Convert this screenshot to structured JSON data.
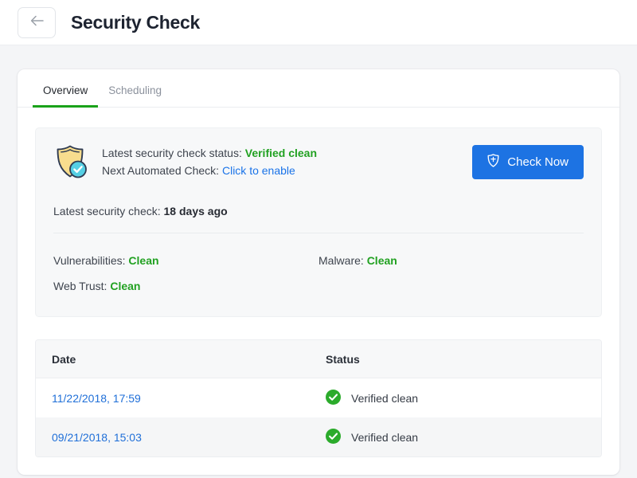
{
  "header": {
    "back_icon": "arrow-left-icon",
    "title": "Security Check"
  },
  "tabs": [
    {
      "label": "Overview",
      "active": true
    },
    {
      "label": "Scheduling",
      "active": false
    }
  ],
  "summary": {
    "shield_icon": "shield-check-icon",
    "status_label": "Latest security check status:",
    "status_value": "Verified clean",
    "next_check_label": "Next Automated Check:",
    "next_check_action": "Click to enable",
    "check_now_label": "Check Now",
    "check_now_icon": "shield-icon",
    "latest_label": "Latest security check:",
    "latest_value": "18 days ago",
    "metrics": [
      {
        "label": "Vulnerabilities:",
        "value": "Clean"
      },
      {
        "label": "Malware:",
        "value": "Clean"
      },
      {
        "label": "Web Trust:",
        "value": "Clean"
      }
    ]
  },
  "table": {
    "columns": [
      "Date",
      "Status"
    ],
    "rows": [
      {
        "date": "11/22/2018, 17:59",
        "status": "Verified clean",
        "status_icon": "check-circle-icon"
      },
      {
        "date": "09/21/2018, 15:03",
        "status": "Verified clean",
        "status_icon": "check-circle-icon"
      }
    ]
  },
  "colors": {
    "accent_blue": "#1d73e3",
    "link_blue": "#1a73e8",
    "success_green": "#21a121",
    "tab_underline": "#19a219",
    "shield_fill": "#f8dd8e",
    "badge_cyan": "#55cfe4",
    "page_bg": "#f4f5f7"
  }
}
